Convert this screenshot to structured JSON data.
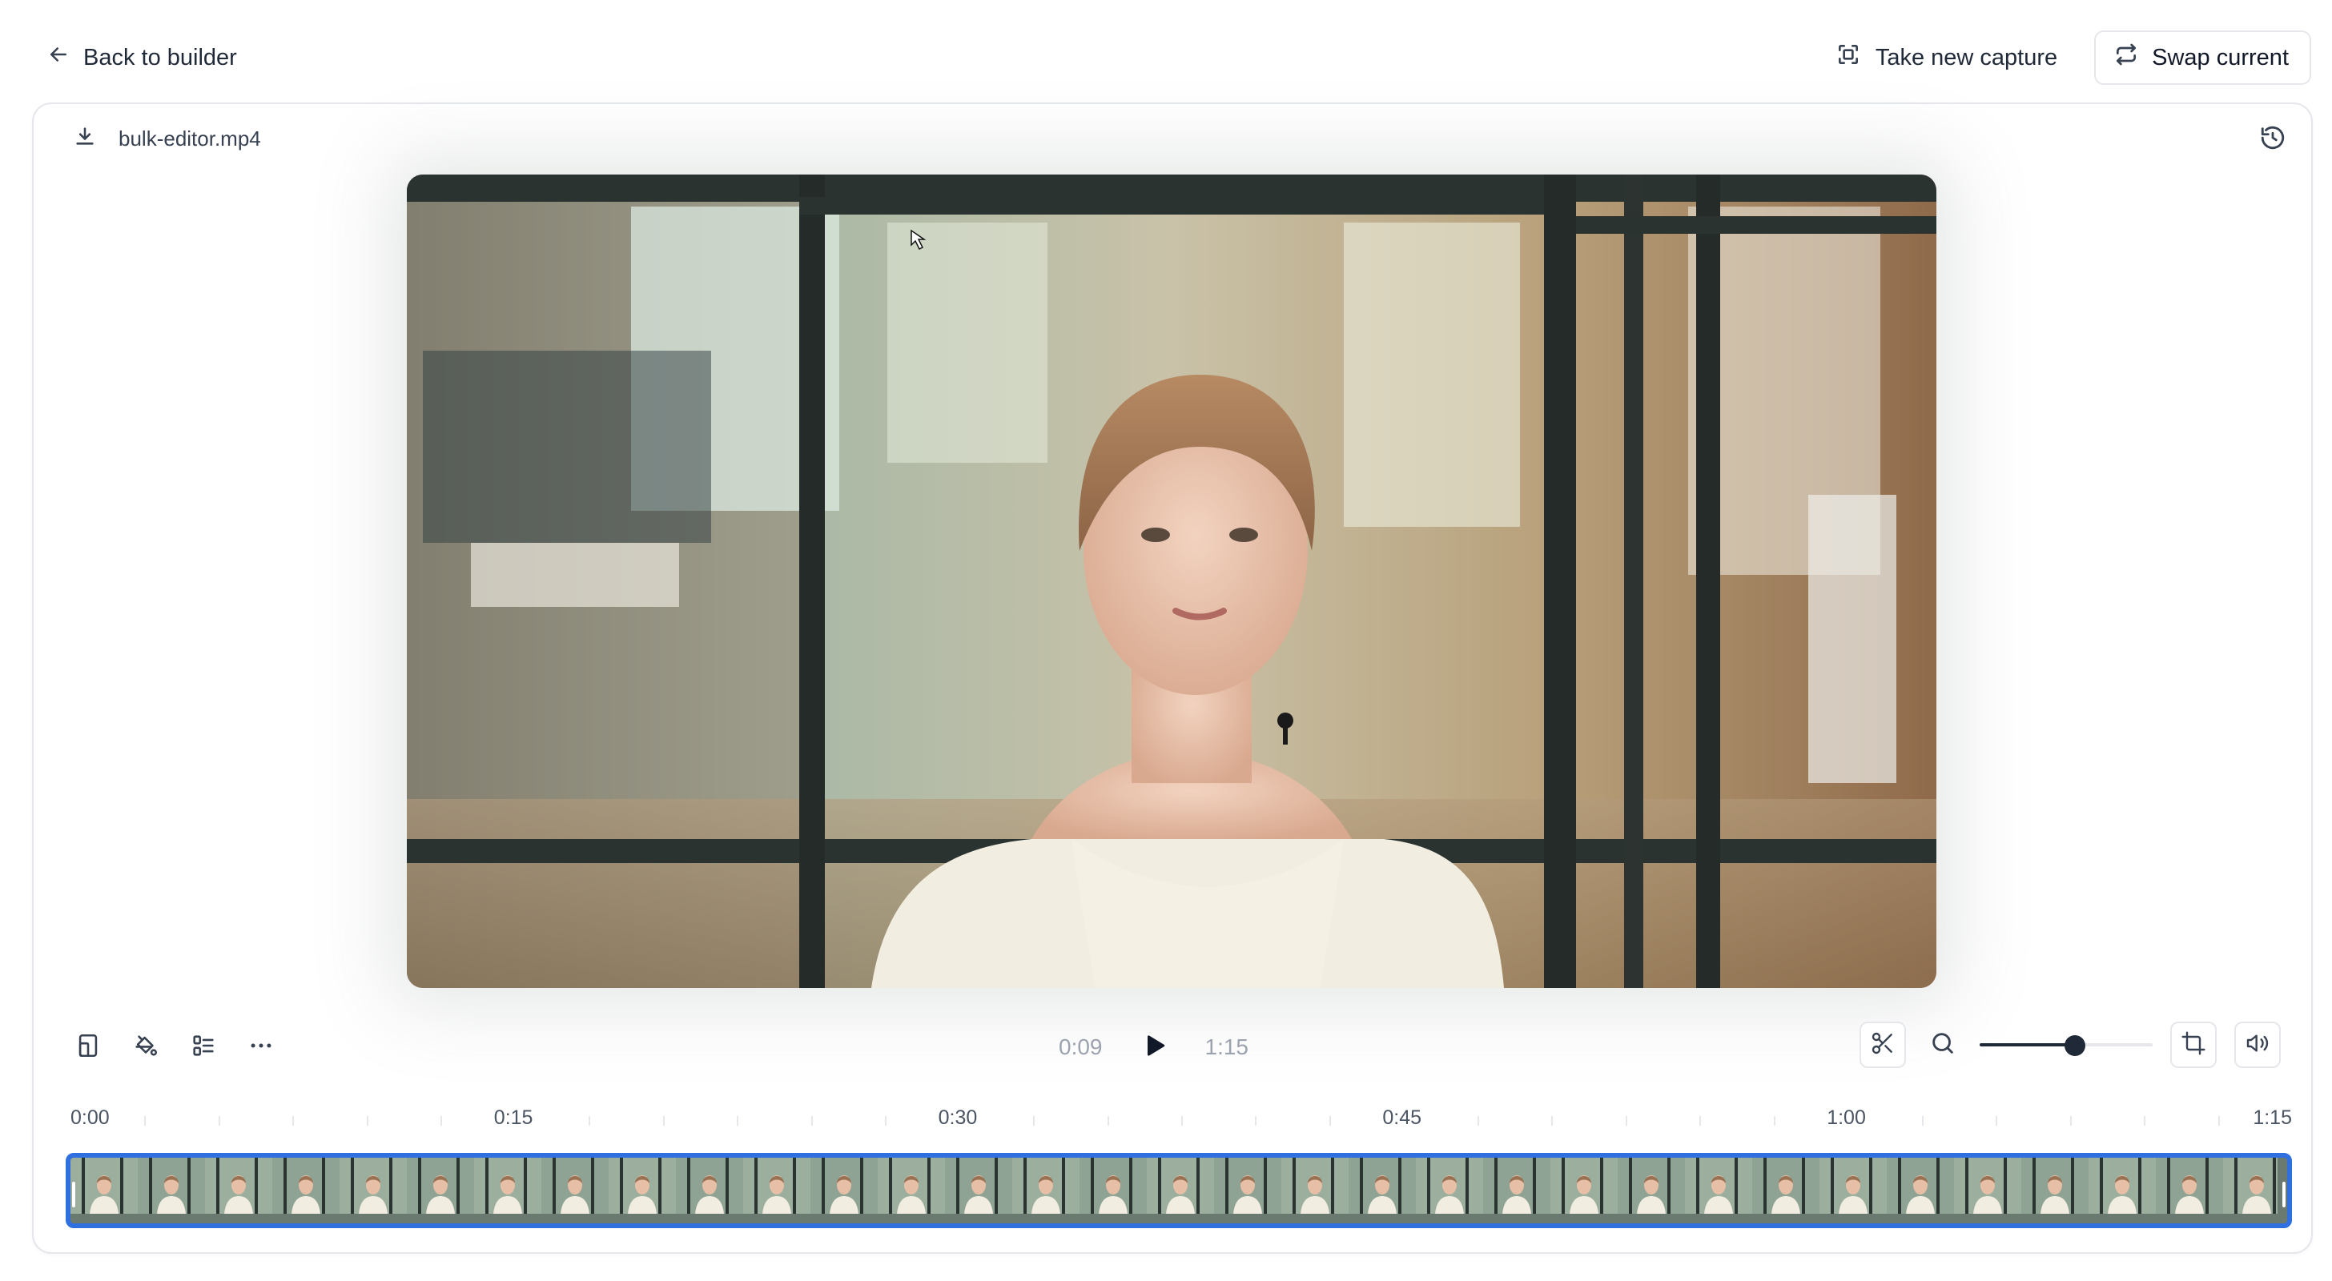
{
  "topbar": {
    "back_label": "Back to builder",
    "take_capture_label": "Take new capture",
    "swap_label": "Swap current"
  },
  "file": {
    "name": "bulk-editor.mp4"
  },
  "player": {
    "current_time": "0:09",
    "duration": "1:15",
    "zoom_level": 0.55
  },
  "timeline": {
    "labels": [
      "0:00",
      "0:15",
      "0:30",
      "0:45",
      "1:00",
      "1:15"
    ],
    "selection_color": "#2f6fe0"
  },
  "icons": {
    "back": "arrow-left-icon",
    "capture": "capture-frame-icon",
    "swap": "swap-arrows-icon",
    "download": "download-icon",
    "history": "history-icon",
    "layout": "aspect-ratio-icon",
    "fill": "paint-bucket-icon",
    "align": "align-icon",
    "more": "more-dots-icon",
    "play": "play-icon",
    "cut": "scissors-icon",
    "zoom": "zoom-icon",
    "crop": "crop-icon",
    "volume": "volume-icon"
  },
  "colors": {
    "accent": "#2f6fe0",
    "text": "#1f2937",
    "muted": "#9ca3af",
    "border": "#e5e7eb"
  }
}
